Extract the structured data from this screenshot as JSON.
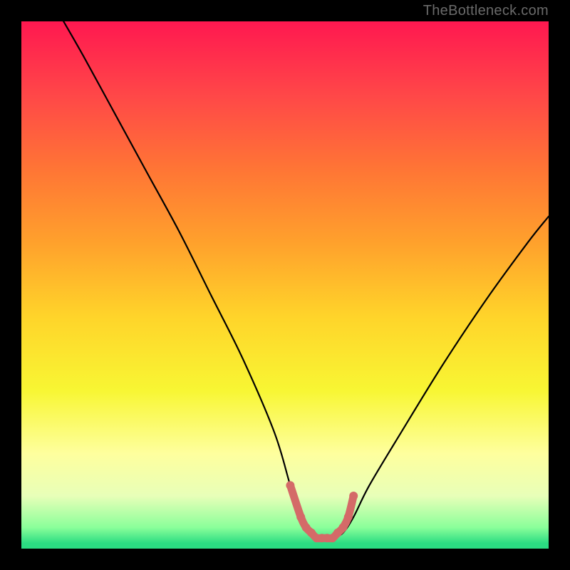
{
  "watermark": "TheBottleneck.com",
  "chart_data": {
    "type": "line",
    "title": "",
    "xlabel": "",
    "ylabel": "",
    "xlim": [
      0,
      100
    ],
    "ylim": [
      0,
      100
    ],
    "series": [
      {
        "name": "main-curve",
        "color": "#000000",
        "x": [
          8,
          12,
          18,
          24,
          30,
          36,
          42,
          48,
          51,
          53,
          55,
          57,
          59,
          61,
          63,
          66,
          72,
          80,
          88,
          96,
          100
        ],
        "y": [
          100,
          93,
          82,
          71,
          60,
          48,
          36,
          22,
          12,
          6,
          3,
          2,
          2,
          3,
          6,
          12,
          22,
          35,
          47,
          58,
          63
        ]
      },
      {
        "name": "bottom-marker",
        "color": "#d46a68",
        "x": [
          51,
          53,
          54,
          55,
          56,
          57,
          58,
          59,
          60,
          61,
          62,
          63
        ],
        "y": [
          12,
          6,
          4,
          3,
          2,
          2,
          2,
          2,
          3,
          4,
          6,
          10
        ]
      }
    ],
    "gradient_stops": [
      {
        "pct": 0,
        "color": "#ff1850"
      },
      {
        "pct": 14,
        "color": "#ff4748"
      },
      {
        "pct": 28,
        "color": "#ff7535"
      },
      {
        "pct": 42,
        "color": "#ffa12c"
      },
      {
        "pct": 56,
        "color": "#ffd42a"
      },
      {
        "pct": 70,
        "color": "#f8f633"
      },
      {
        "pct": 82,
        "color": "#feff9e"
      },
      {
        "pct": 90,
        "color": "#e8ffb8"
      },
      {
        "pct": 96,
        "color": "#8aff9a"
      },
      {
        "pct": 99,
        "color": "#2bdc82"
      },
      {
        "pct": 100,
        "color": "#2bdc82"
      }
    ]
  }
}
